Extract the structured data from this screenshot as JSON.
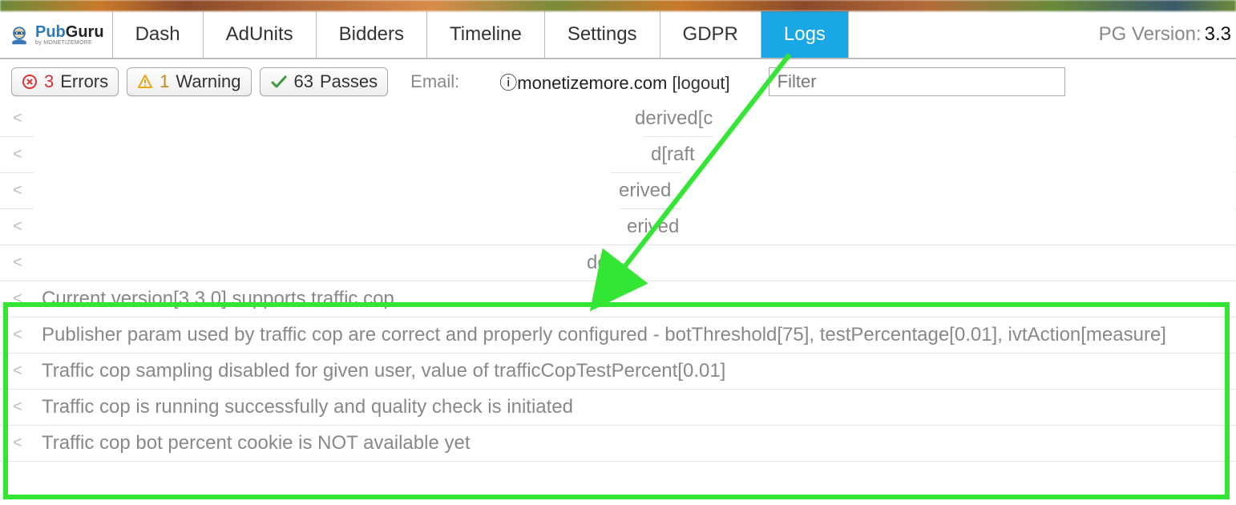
{
  "logo": {
    "brand_a": "Pub",
    "brand_b": "Guru",
    "sub": "by MONETIZEMORE"
  },
  "nav": {
    "tabs": [
      "Dash",
      "AdUnits",
      "Bidders",
      "Timeline",
      "Settings",
      "GDPR",
      "Logs"
    ],
    "active": "Logs"
  },
  "version": {
    "label": "PG Version:",
    "value": "3.3"
  },
  "status": {
    "errors_count": "3",
    "errors_label": "Errors",
    "warn_count": "1",
    "warn_label": "Warning",
    "passes_count": "63",
    "passes_label": "Passes"
  },
  "auth": {
    "email_label": "Email:",
    "email_domain": "monetizemore.com",
    "email_prefix_glyph": "ⓘ",
    "logout": "[logout]"
  },
  "filter": {
    "placeholder": "Filter"
  },
  "log_fragments": {
    "r1": "derived[c",
    "r2": "d[raft",
    "r3": "erived",
    "r4": "erived",
    "r5": "de"
  },
  "logs_highlighted": [
    "Current version[3.3.0] supports traffic cop",
    "Publisher param used by traffic cop are correct and properly configured - botThreshold[75], testPercentage[0.01], ivtAction[measure]",
    "Traffic cop sampling disabled for given user, value of trafficCopTestPercent[0.01]",
    "Traffic cop is running successfully and quality check is initiated",
    "Traffic cop bot percent cookie is NOT available yet"
  ]
}
